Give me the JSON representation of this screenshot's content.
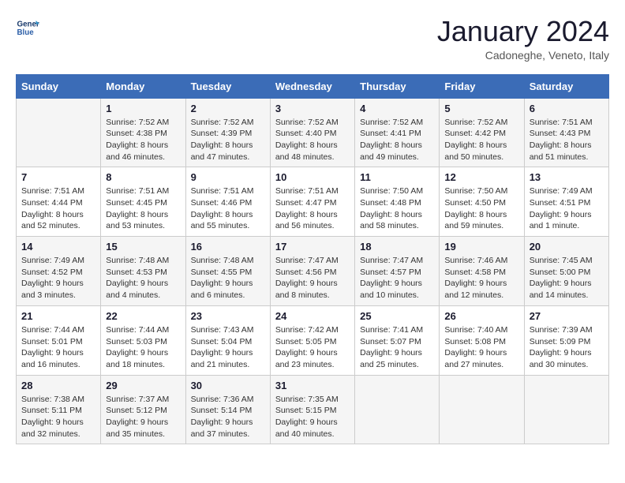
{
  "header": {
    "logo_line1": "General",
    "logo_line2": "Blue",
    "month": "January 2024",
    "location": "Cadoneghe, Veneto, Italy"
  },
  "weekdays": [
    "Sunday",
    "Monday",
    "Tuesday",
    "Wednesday",
    "Thursday",
    "Friday",
    "Saturday"
  ],
  "weeks": [
    [
      {
        "day": "",
        "info": ""
      },
      {
        "day": "1",
        "info": "Sunrise: 7:52 AM\nSunset: 4:38 PM\nDaylight: 8 hours\nand 46 minutes."
      },
      {
        "day": "2",
        "info": "Sunrise: 7:52 AM\nSunset: 4:39 PM\nDaylight: 8 hours\nand 47 minutes."
      },
      {
        "day": "3",
        "info": "Sunrise: 7:52 AM\nSunset: 4:40 PM\nDaylight: 8 hours\nand 48 minutes."
      },
      {
        "day": "4",
        "info": "Sunrise: 7:52 AM\nSunset: 4:41 PM\nDaylight: 8 hours\nand 49 minutes."
      },
      {
        "day": "5",
        "info": "Sunrise: 7:52 AM\nSunset: 4:42 PM\nDaylight: 8 hours\nand 50 minutes."
      },
      {
        "day": "6",
        "info": "Sunrise: 7:51 AM\nSunset: 4:43 PM\nDaylight: 8 hours\nand 51 minutes."
      }
    ],
    [
      {
        "day": "7",
        "info": "Sunrise: 7:51 AM\nSunset: 4:44 PM\nDaylight: 8 hours\nand 52 minutes."
      },
      {
        "day": "8",
        "info": "Sunrise: 7:51 AM\nSunset: 4:45 PM\nDaylight: 8 hours\nand 53 minutes."
      },
      {
        "day": "9",
        "info": "Sunrise: 7:51 AM\nSunset: 4:46 PM\nDaylight: 8 hours\nand 55 minutes."
      },
      {
        "day": "10",
        "info": "Sunrise: 7:51 AM\nSunset: 4:47 PM\nDaylight: 8 hours\nand 56 minutes."
      },
      {
        "day": "11",
        "info": "Sunrise: 7:50 AM\nSunset: 4:48 PM\nDaylight: 8 hours\nand 58 minutes."
      },
      {
        "day": "12",
        "info": "Sunrise: 7:50 AM\nSunset: 4:50 PM\nDaylight: 8 hours\nand 59 minutes."
      },
      {
        "day": "13",
        "info": "Sunrise: 7:49 AM\nSunset: 4:51 PM\nDaylight: 9 hours\nand 1 minute."
      }
    ],
    [
      {
        "day": "14",
        "info": "Sunrise: 7:49 AM\nSunset: 4:52 PM\nDaylight: 9 hours\nand 3 minutes."
      },
      {
        "day": "15",
        "info": "Sunrise: 7:48 AM\nSunset: 4:53 PM\nDaylight: 9 hours\nand 4 minutes."
      },
      {
        "day": "16",
        "info": "Sunrise: 7:48 AM\nSunset: 4:55 PM\nDaylight: 9 hours\nand 6 minutes."
      },
      {
        "day": "17",
        "info": "Sunrise: 7:47 AM\nSunset: 4:56 PM\nDaylight: 9 hours\nand 8 minutes."
      },
      {
        "day": "18",
        "info": "Sunrise: 7:47 AM\nSunset: 4:57 PM\nDaylight: 9 hours\nand 10 minutes."
      },
      {
        "day": "19",
        "info": "Sunrise: 7:46 AM\nSunset: 4:58 PM\nDaylight: 9 hours\nand 12 minutes."
      },
      {
        "day": "20",
        "info": "Sunrise: 7:45 AM\nSunset: 5:00 PM\nDaylight: 9 hours\nand 14 minutes."
      }
    ],
    [
      {
        "day": "21",
        "info": "Sunrise: 7:44 AM\nSunset: 5:01 PM\nDaylight: 9 hours\nand 16 minutes."
      },
      {
        "day": "22",
        "info": "Sunrise: 7:44 AM\nSunset: 5:03 PM\nDaylight: 9 hours\nand 18 minutes."
      },
      {
        "day": "23",
        "info": "Sunrise: 7:43 AM\nSunset: 5:04 PM\nDaylight: 9 hours\nand 21 minutes."
      },
      {
        "day": "24",
        "info": "Sunrise: 7:42 AM\nSunset: 5:05 PM\nDaylight: 9 hours\nand 23 minutes."
      },
      {
        "day": "25",
        "info": "Sunrise: 7:41 AM\nSunset: 5:07 PM\nDaylight: 9 hours\nand 25 minutes."
      },
      {
        "day": "26",
        "info": "Sunrise: 7:40 AM\nSunset: 5:08 PM\nDaylight: 9 hours\nand 27 minutes."
      },
      {
        "day": "27",
        "info": "Sunrise: 7:39 AM\nSunset: 5:09 PM\nDaylight: 9 hours\nand 30 minutes."
      }
    ],
    [
      {
        "day": "28",
        "info": "Sunrise: 7:38 AM\nSunset: 5:11 PM\nDaylight: 9 hours\nand 32 minutes."
      },
      {
        "day": "29",
        "info": "Sunrise: 7:37 AM\nSunset: 5:12 PM\nDaylight: 9 hours\nand 35 minutes."
      },
      {
        "day": "30",
        "info": "Sunrise: 7:36 AM\nSunset: 5:14 PM\nDaylight: 9 hours\nand 37 minutes."
      },
      {
        "day": "31",
        "info": "Sunrise: 7:35 AM\nSunset: 5:15 PM\nDaylight: 9 hours\nand 40 minutes."
      },
      {
        "day": "",
        "info": ""
      },
      {
        "day": "",
        "info": ""
      },
      {
        "day": "",
        "info": ""
      }
    ]
  ]
}
